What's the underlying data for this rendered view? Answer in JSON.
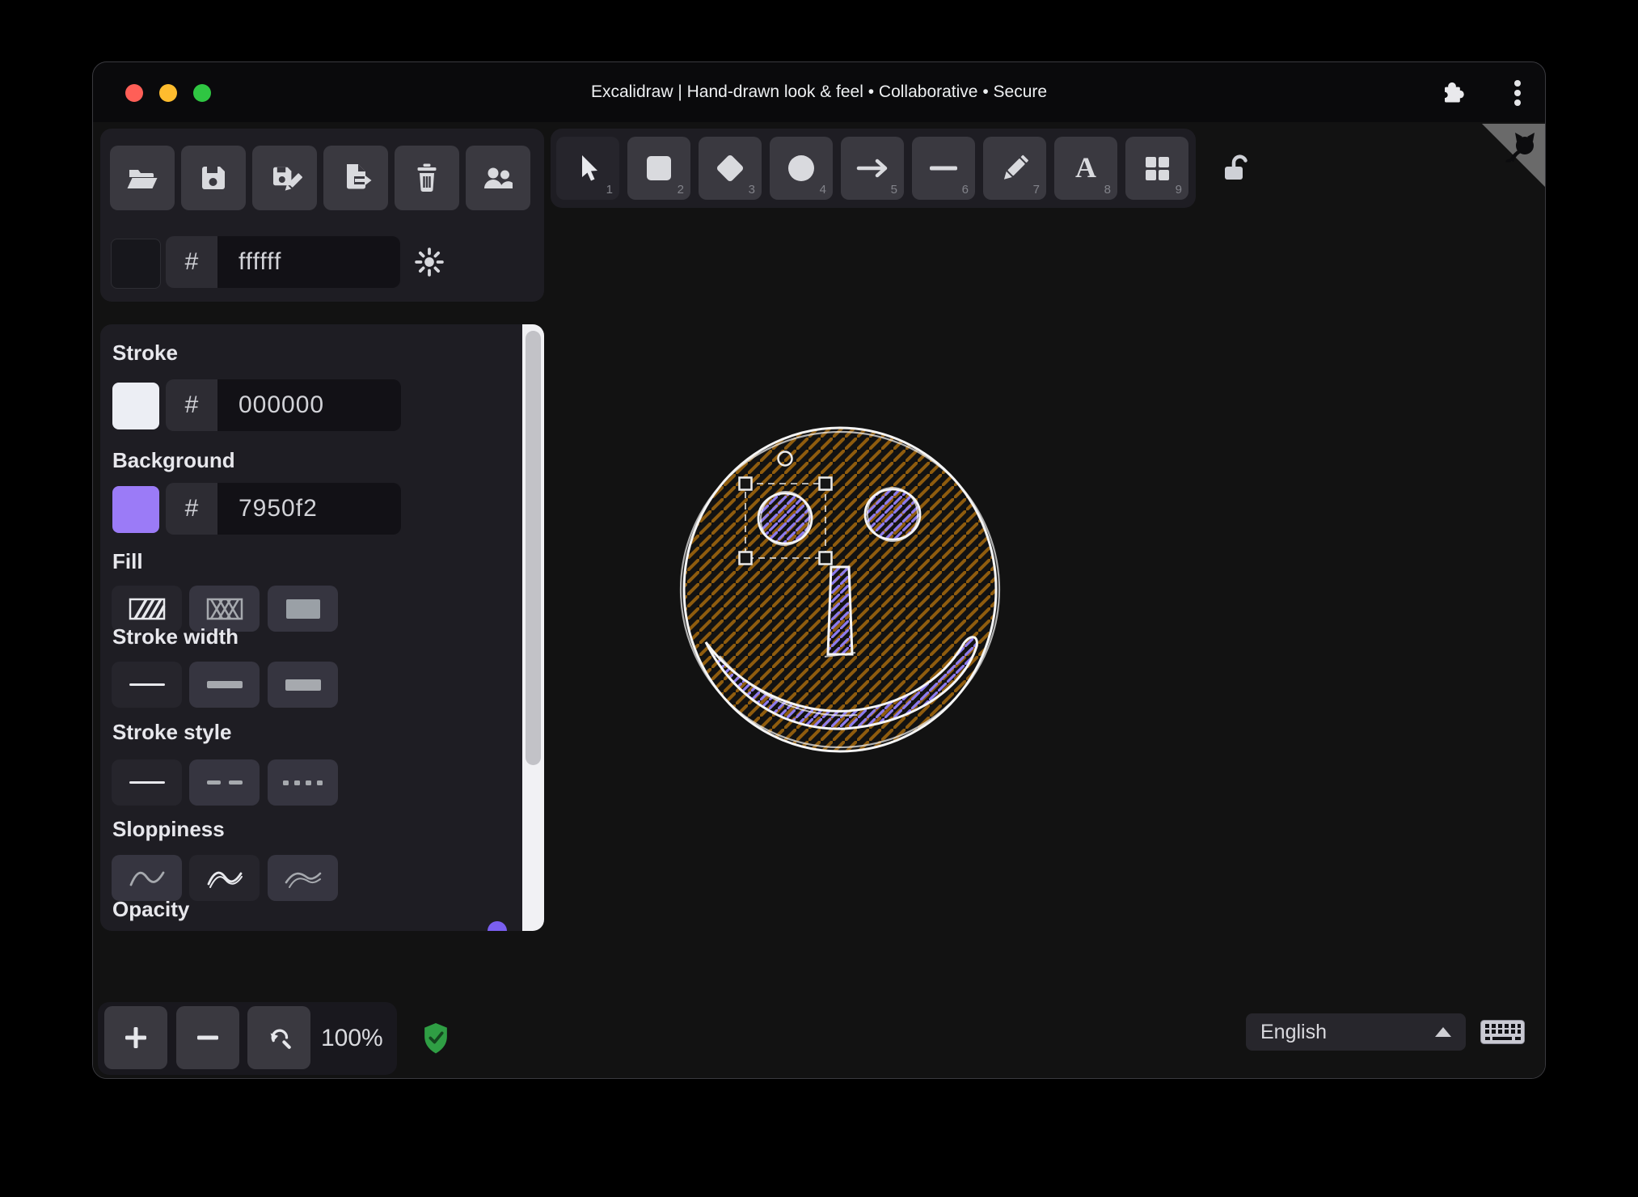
{
  "window": {
    "title": "Excalidraw | Hand-drawn look & feel • Collaborative • Secure",
    "traffic_lights": [
      "close",
      "minimize",
      "zoom"
    ],
    "titlebar_icons": [
      "extensions-puzzle-icon",
      "overflow-menu-icon"
    ]
  },
  "file_toolbar": {
    "icons": [
      "open-file",
      "save",
      "save-as",
      "export",
      "clear-canvas-trash",
      "collaborators"
    ]
  },
  "canvas_background": {
    "hash_prefix": "#",
    "value": "ffffff",
    "swatch_color": "#17171c",
    "theme_icon": "sun"
  },
  "tools": [
    {
      "name": "selection",
      "shortcut": "1",
      "active": true
    },
    {
      "name": "rectangle",
      "shortcut": "2",
      "active": false
    },
    {
      "name": "diamond",
      "shortcut": "3",
      "active": false
    },
    {
      "name": "ellipse",
      "shortcut": "4",
      "active": false
    },
    {
      "name": "arrow",
      "shortcut": "5",
      "active": false
    },
    {
      "name": "line",
      "shortcut": "6",
      "active": false
    },
    {
      "name": "draw",
      "shortcut": "7",
      "active": false
    },
    {
      "name": "text",
      "shortcut": "8",
      "active": false
    },
    {
      "name": "library",
      "shortcut": "9",
      "active": false
    }
  ],
  "lock": {
    "icon": "unlocked-padlock"
  },
  "panel": {
    "stroke": {
      "label": "Stroke",
      "hash_prefix": "#",
      "value": "000000",
      "swatch_color": "#eceef4"
    },
    "background": {
      "label": "Background",
      "hash_prefix": "#",
      "value": "7950f2",
      "swatch_color": "#9b7bf7"
    },
    "fill": {
      "label": "Fill",
      "options": [
        "hachure",
        "cross-hatch",
        "solid"
      ],
      "active": "hachure"
    },
    "stroke_width": {
      "label": "Stroke width",
      "options": [
        "thin",
        "bold",
        "extra-bold"
      ],
      "active": "thin"
    },
    "stroke_style": {
      "label": "Stroke style",
      "options": [
        "solid",
        "dashed",
        "dotted"
      ],
      "active": "solid"
    },
    "sloppiness": {
      "label": "Sloppiness",
      "options": [
        "architect",
        "artist",
        "cartoonist"
      ],
      "active": "artist"
    },
    "opacity": {
      "label": "Opacity"
    }
  },
  "footer": {
    "zoom_icons": [
      "zoom-in",
      "zoom-out",
      "reset-zoom"
    ],
    "zoom_value": "100%",
    "shield_icon": "shield-check",
    "language_value": "English",
    "keyboard_icon": "keyboard"
  },
  "github_corner": {
    "icon": "octocat"
  },
  "drawing": {
    "description": "hand-drawn smiley face with selected left eye",
    "face_hachure_color": "#8f5c0e",
    "feature_hachure_color": "#8d7bef",
    "outline_color": "#f5f5f5",
    "selection": "dashed selection box with corner handles and rotation handle around left eye"
  }
}
